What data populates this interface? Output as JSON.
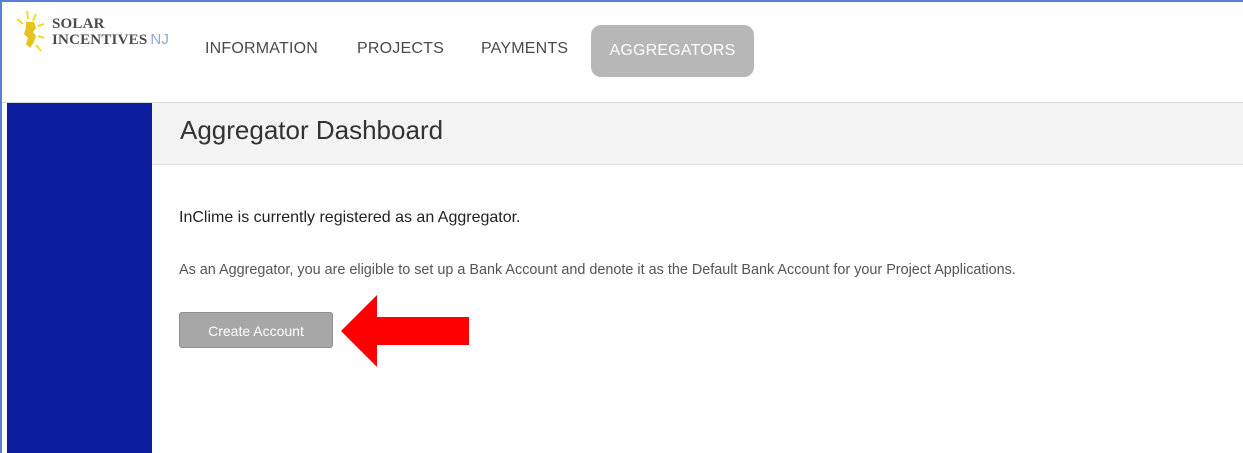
{
  "logo": {
    "line1": "SOLAR",
    "line2": "INCENTIVES",
    "suffix": "NJ"
  },
  "nav": {
    "items": [
      {
        "label": "INFORMATION"
      },
      {
        "label": "PROJECTS"
      },
      {
        "label": "PAYMENTS"
      }
    ],
    "active": {
      "label": "AGGREGATORS"
    }
  },
  "dashboard": {
    "title": "Aggregator Dashboard",
    "registered_text": "InClime is currently registered as an Aggregator.",
    "eligible_text": "As an Aggregator, you are eligible to set up a Bank Account and denote it as the Default Bank Account for your Project Applications.",
    "create_button_label": "Create Account"
  },
  "colors": {
    "sidebar": "#0c1c9e",
    "active_tab": "#b7b7b7",
    "arrow": "#ff0000",
    "logo_accent": "#f2dc2b"
  }
}
